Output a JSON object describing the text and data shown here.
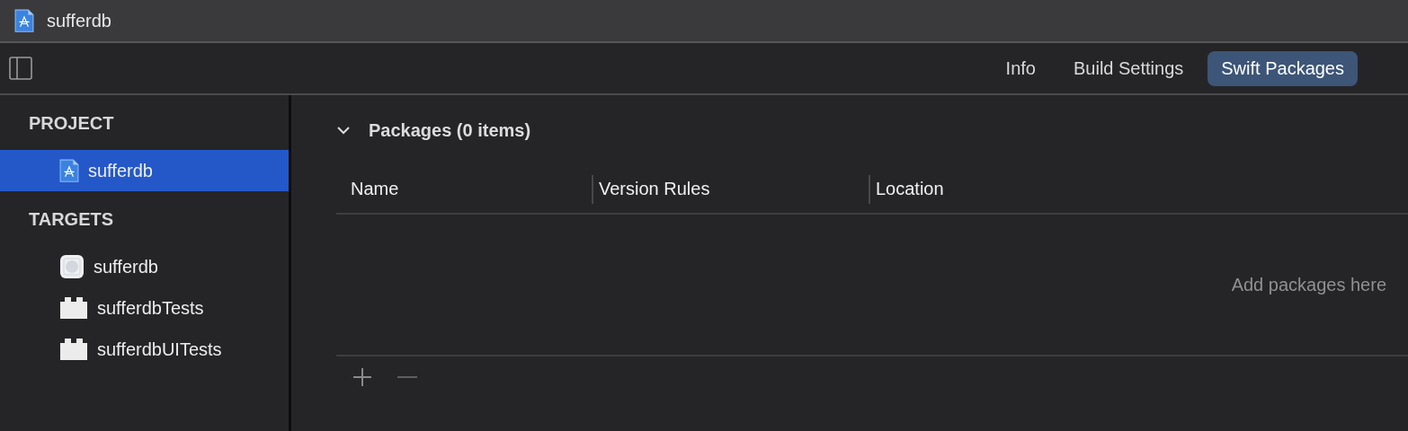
{
  "window": {
    "title": "sufferdb"
  },
  "tabs": [
    {
      "label": "Info",
      "selected": false
    },
    {
      "label": "Build Settings",
      "selected": false
    },
    {
      "label": "Swift Packages",
      "selected": true
    }
  ],
  "sidebar": {
    "sections": [
      {
        "title": "PROJECT",
        "items": [
          {
            "label": "sufferdb",
            "kind": "project",
            "selected": true
          }
        ]
      },
      {
        "title": "TARGETS",
        "items": [
          {
            "label": "sufferdb",
            "kind": "app",
            "selected": false
          },
          {
            "label": "sufferdbTests",
            "kind": "bundle",
            "selected": false
          },
          {
            "label": "sufferdbUITests",
            "kind": "bundle",
            "selected": false
          }
        ]
      }
    ]
  },
  "packages": {
    "title": "Packages (0 items)",
    "expanded": true,
    "columns": [
      "Name",
      "Version Rules",
      "Location"
    ],
    "empty_text": "Add packages here"
  }
}
